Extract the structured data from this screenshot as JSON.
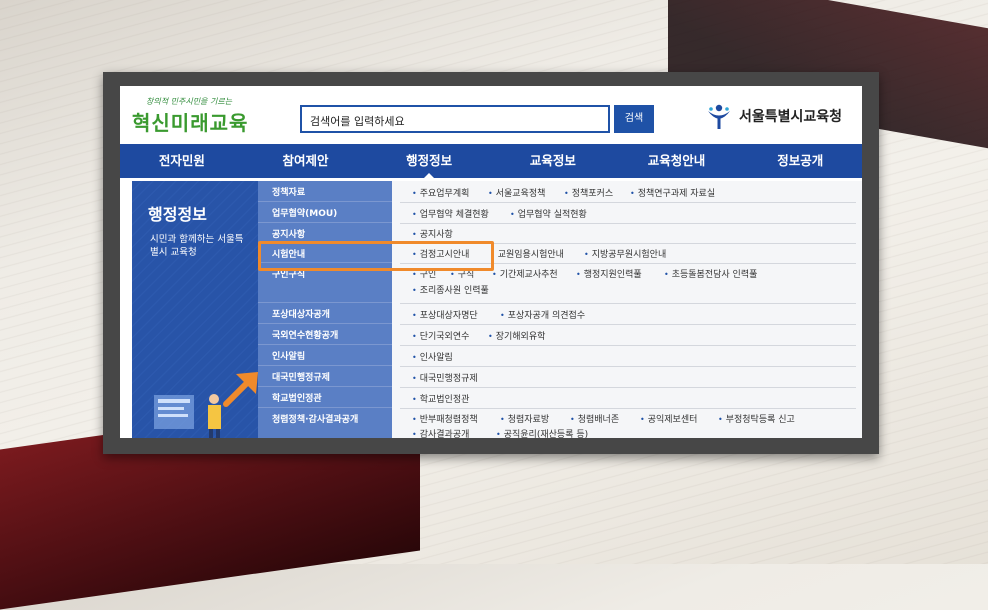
{
  "header": {
    "logo_tagline": "창의적 민주시민을 기르는",
    "logo_name": "혁신미래교육",
    "search_placeholder": "검색어를 입력하세요",
    "search_button": "검색",
    "office_name": "서울특별시교육청"
  },
  "nav": [
    "전자민원",
    "참여제안",
    "행정정보",
    "교육정보",
    "교육청안내",
    "정보공개"
  ],
  "side": {
    "title": "행정정보",
    "subtitle": "시민과 함께하는 서울특별시 교육청"
  },
  "menu": [
    {
      "label": "정책자료",
      "links": [
        "주요업무계획",
        "서울교육정책",
        "정책포커스",
        "정책연구과제 자료실"
      ]
    },
    {
      "label": "업무협약(MOU)",
      "links": [
        "업무협약 체결현황",
        "업무협약 실적현황"
      ]
    },
    {
      "label": "공지사항",
      "links": [
        "공지사항"
      ]
    },
    {
      "label": "시험안내",
      "links": [
        "검정고시안내",
        "교원임용시험안내",
        "지방공무원시험안내"
      ]
    },
    {
      "label": "구인구직",
      "links": [
        "구인",
        "구직",
        "기간제교사추천",
        "행정지원인력풀",
        "초등돌봄전담사 인력풀",
        "조리종사원 인력풀"
      ]
    },
    {
      "label": "포상대상자공개",
      "links": [
        "포상대상자명단",
        "포상자공개 의견접수"
      ]
    },
    {
      "label": "국외연수현황공개",
      "links": [
        "단기국외연수",
        "장기해외유학"
      ]
    },
    {
      "label": "인사알림",
      "links": [
        "인사알림"
      ]
    },
    {
      "label": "대국민행정규제",
      "links": [
        "대국민행정규제"
      ]
    },
    {
      "label": "학교법인정관",
      "links": [
        "학교법인정관"
      ]
    },
    {
      "label": "청렴정책·감사결과공개",
      "links": [
        "반부패청렴정책",
        "청렴자료방",
        "청렴배너존",
        "공익제보센터",
        "부정청탁등록 신고",
        "감사결과공개",
        "공직윤리(재산등록 등)"
      ]
    }
  ],
  "colors": {
    "brand_blue": "#1e4aa0",
    "highlight_orange": "#f08a2b",
    "logo_green": "#3a9a2f"
  }
}
